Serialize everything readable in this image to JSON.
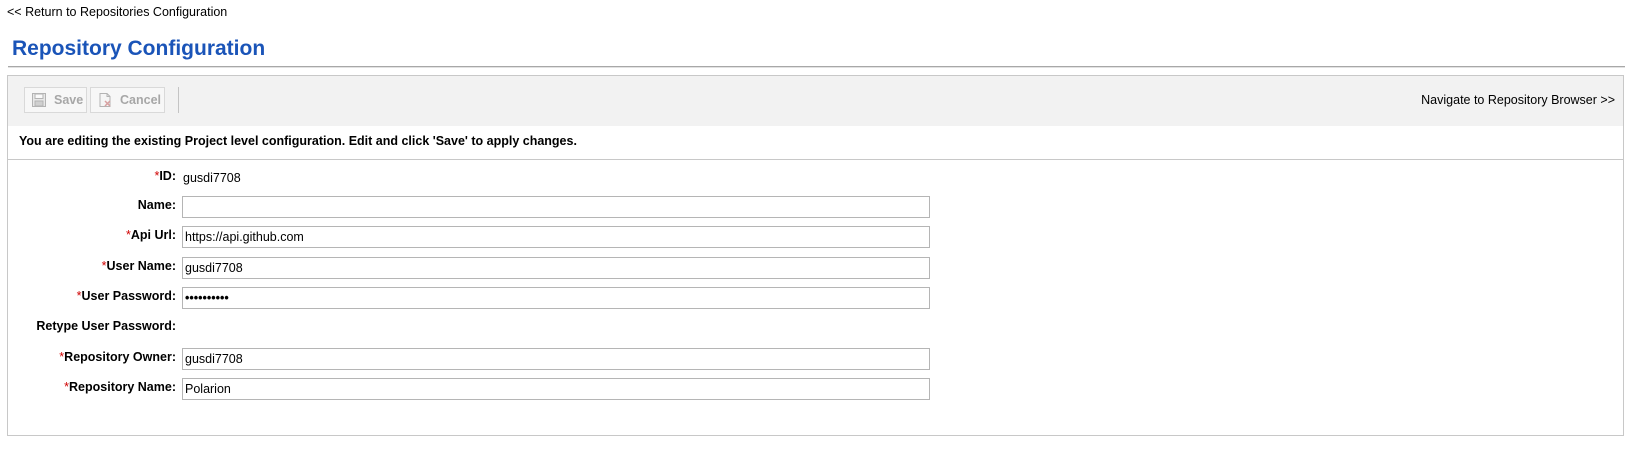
{
  "back_link": "<< Return to Repositories Configuration",
  "page_title": "Repository Configuration",
  "toolbar": {
    "save_label": "Save",
    "cancel_label": "Cancel",
    "navigate_label": "Navigate to Repository Browser >>"
  },
  "info_message": "You are editing the existing Project level configuration. Edit and click 'Save' to apply changes.",
  "required_marker": "*",
  "form": {
    "id": {
      "label": "ID:",
      "value": "gusdi7708"
    },
    "name": {
      "label": "Name:",
      "value": ""
    },
    "api_url": {
      "label": "Api Url:",
      "value": "https://api.github.com"
    },
    "user_name": {
      "label": "User Name:",
      "value": "gusdi7708"
    },
    "user_password": {
      "label": "User Password:",
      "value": "••••••••••"
    },
    "retype_password": {
      "label": "Retype User Password:"
    },
    "repository_owner": {
      "label": "Repository Owner:",
      "value": "gusdi7708"
    },
    "repository_name": {
      "label": "Repository Name:",
      "value": "Polarion"
    }
  },
  "colors": {
    "title": "#1a54b8",
    "required": "#d00000",
    "toolbar_bg": "#f2f2f2",
    "disabled_text": "#a7a7a7"
  }
}
